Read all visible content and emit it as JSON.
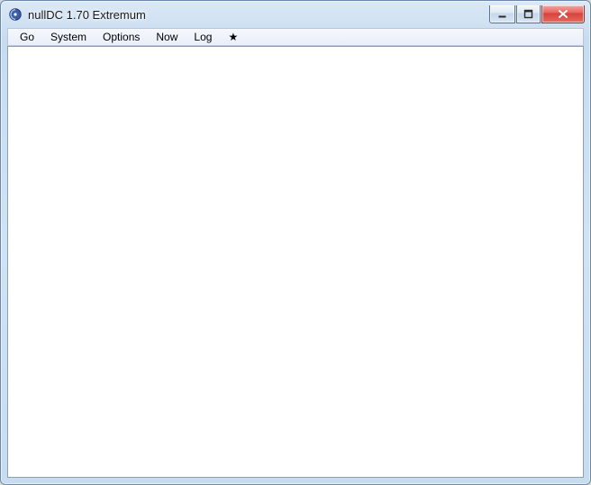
{
  "window": {
    "title": "nullDC 1.70 Extremum"
  },
  "menubar": {
    "items": [
      {
        "label": "Go"
      },
      {
        "label": "System"
      },
      {
        "label": "Options"
      },
      {
        "label": "Now"
      },
      {
        "label": "Log"
      },
      {
        "label": "★"
      }
    ]
  }
}
